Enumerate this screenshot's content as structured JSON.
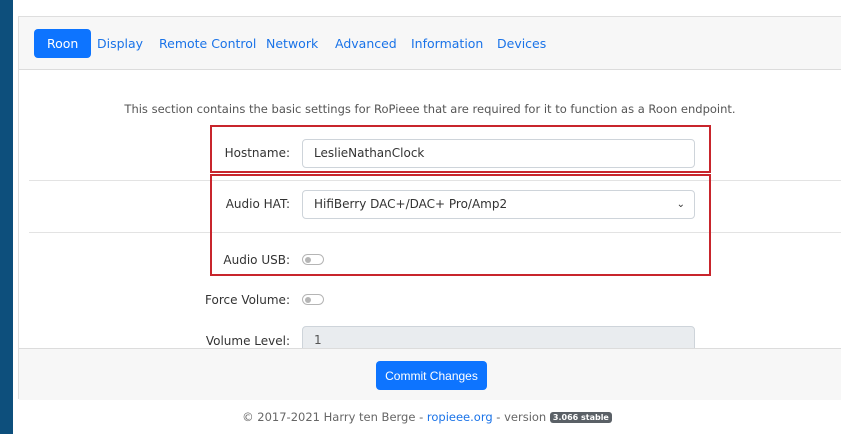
{
  "tabs": [
    {
      "label": "Roon",
      "active": true
    },
    {
      "label": "Display"
    },
    {
      "label": "Remote Control"
    },
    {
      "label": "Network"
    },
    {
      "label": "Advanced"
    },
    {
      "label": "Information"
    },
    {
      "label": "Devices"
    }
  ],
  "intro": "This section contains the basic settings for RoPieee that are required for it to function as a Roon endpoint.",
  "form": {
    "hostname_label": "Hostname:",
    "hostname_value": "LeslieNathanClock",
    "audio_hat_label": "Audio HAT:",
    "audio_hat_value": "HifiBerry DAC+/DAC+ Pro/Amp2",
    "audio_usb_label": "Audio USB:",
    "audio_usb_on": false,
    "force_volume_label": "Force Volume:",
    "force_volume_on": false,
    "volume_level_label": "Volume Level:",
    "volume_level_value": "1"
  },
  "commit_label": "Commit Changes",
  "footer": {
    "prefix": "© 2017-2021 Harry ten Berge - ",
    "link": "ropieee.org",
    "middle": " - version ",
    "version": "3.066 stable"
  },
  "colors": {
    "accent": "#0d74ff",
    "highlight": "#c8252c",
    "frame": "#0d4f7c"
  }
}
